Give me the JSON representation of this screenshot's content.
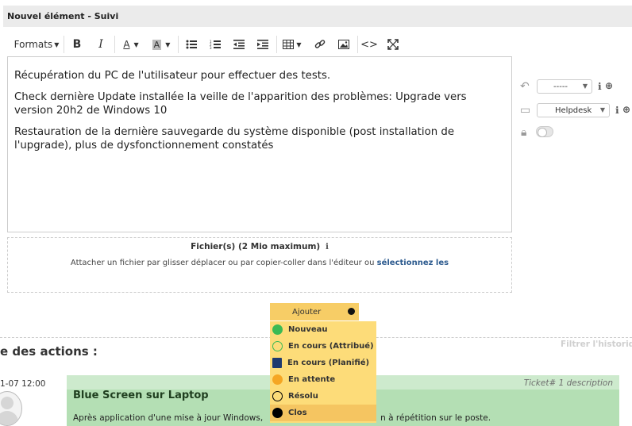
{
  "header": {
    "title": "Nouvel élément - Suivi"
  },
  "toolbar": {
    "formats_label": "Formats"
  },
  "editor": {
    "paragraphs": [
      "Récupération du PC de l'utilisateur pour effectuer des tests.",
      "Check dernière Update installée la veille de l'apparition des problèmes: Upgrade vers version 20h2 de Windows 10",
      "Restauration de la dernière sauvegarde du système disponible (post installation de l'upgrade), plus de dysfonctionnement constatés"
    ]
  },
  "dropzone": {
    "title": "Fichier(s) (2 Mio maximum)",
    "text": "Attacher un fichier par glisser déplacer ou par copier-coller dans l'éditeur ou",
    "link": "sélectionnez les"
  },
  "sidebar": {
    "template_select": "-----",
    "source_select": "Helpdesk"
  },
  "add_button": {
    "label": "Ajouter"
  },
  "status_menu": [
    {
      "label": "Nouveau",
      "icon": "green-filled-circle-icon",
      "color": "#3cba54"
    },
    {
      "label": "En cours (Attribué)",
      "icon": "green-outline-circle-icon",
      "color": "#3cba54"
    },
    {
      "label": "En cours (Planifié)",
      "icon": "calendar-icon",
      "color": "#1f3a6e"
    },
    {
      "label": "En attente",
      "icon": "orange-filled-circle-icon",
      "color": "#f5a623"
    },
    {
      "label": "Résolu",
      "icon": "black-outline-circle-icon",
      "color": "#000000"
    },
    {
      "label": "Clos",
      "icon": "black-filled-circle-icon",
      "color": "#000000"
    }
  ],
  "timeline": {
    "section_title": "e des actions :",
    "filter_label": "Filtrer l'historiq",
    "date": "1-07 12:00",
    "ticket_meta": "Ticket# 1 description",
    "ticket_title": "Blue Screen sur Laptop",
    "ticket_desc_start": "Après application d'une mise à jour Windows,",
    "ticket_desc_end": "n à répétition sur le poste."
  }
}
